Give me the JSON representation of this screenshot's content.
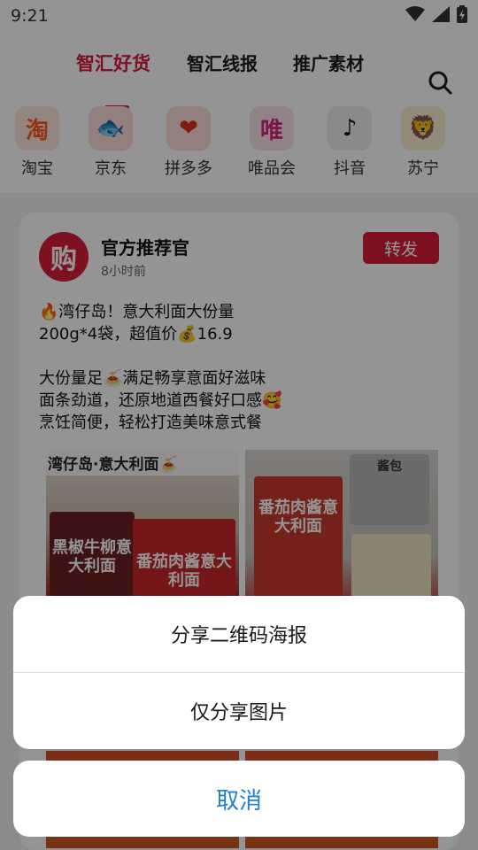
{
  "status_bar": {
    "time": "9:21",
    "icons": [
      "wifi-icon",
      "signal-icon",
      "battery-charging-icon"
    ]
  },
  "tabs": [
    {
      "label": "智汇好货",
      "active": true
    },
    {
      "label": "智汇线报",
      "active": false
    },
    {
      "label": "推广素材",
      "active": false
    }
  ],
  "search_icon": "search-icon",
  "platforms": [
    {
      "label": "淘宝",
      "glyph": "淘",
      "color": "#ff5a1f",
      "bg": "#fde7dc"
    },
    {
      "label": "京东",
      "glyph": "🐟",
      "color": "#e1251b",
      "bg": "#fbdcd9"
    },
    {
      "label": "拼多多",
      "glyph": "❤",
      "color": "#e02e24",
      "bg": "#fbdcd9"
    },
    {
      "label": "唯品会",
      "glyph": "唯",
      "color": "#d6257f",
      "bg": "#fbe0ee"
    },
    {
      "label": "抖音",
      "glyph": "♪",
      "color": "#111111",
      "bg": "#eeeeee"
    },
    {
      "label": "苏宁",
      "glyph": "🦁",
      "color": "#f2a91a",
      "bg": "#fdf0d2"
    }
  ],
  "post": {
    "avatar_glyph": "购",
    "author": "官方推荐官",
    "time": "8小时前",
    "forward_label": "转发",
    "lines": [
      "🔥湾仔岛！意大利面大份量",
      "200g*4袋，超值价💰16.9",
      "",
      "大份量足🍝满足畅享意面好滋味",
      "面条劲道，还原地道西餐好口感🥰",
      "烹饪简便，轻松打造美味意式餐"
    ],
    "photo1_caption": "湾仔岛·意大利面🍝",
    "photo1_pack_a": "黑椒牛柳意大利面",
    "photo1_pack_b": "番茄肉酱意大利面",
    "photo2_pack": "番茄肉酱意大利面",
    "photo2_sauce": "酱包"
  },
  "action_sheet": {
    "option_poster": "分享二维码海报",
    "option_image": "仅分享图片",
    "cancel": "取消"
  },
  "colors": {
    "brand_red": "#d81e3c",
    "cancel_blue": "#1e7fd3"
  }
}
